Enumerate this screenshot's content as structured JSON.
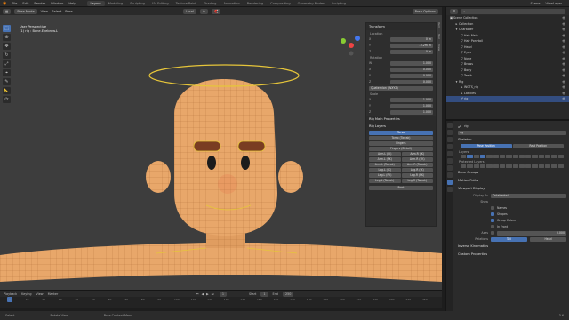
{
  "menu": [
    "File",
    "Edit",
    "Render",
    "Window",
    "Help"
  ],
  "workspaces": [
    "Layout",
    "Modeling",
    "Sculpting",
    "UV Editing",
    "Texture Paint",
    "Shading",
    "Animation",
    "Rendering",
    "Compositing",
    "Geometry Nodes",
    "Scripting"
  ],
  "active_workspace": "Layout",
  "scene": "Scene",
  "view_layer": "ViewLayer",
  "viewport": {
    "mode": "Pose Mode",
    "menus": [
      "View",
      "Select",
      "Pose"
    ],
    "transform_orientation": "Local",
    "overlay_label": "Pose Options",
    "view_name": "User Perspective",
    "context": "(1) rig : Bone.Eyebrow.L"
  },
  "npanel": {
    "tabs": [
      "Item",
      "Tool",
      "View"
    ],
    "transform_header": "Transform",
    "location_label": "Location",
    "location": [
      {
        "axis": "X",
        "value": "0 m"
      },
      {
        "axis": "Y",
        "value": "-0.2m m"
      },
      {
        "axis": "Z",
        "value": "0 m"
      }
    ],
    "rotation_label": "Rotation",
    "rotation": [
      {
        "axis": "W",
        "value": "1.000"
      },
      {
        "axis": "X",
        "value": "0.000"
      },
      {
        "axis": "Y",
        "value": "0.000"
      },
      {
        "axis": "Z",
        "value": "0.000"
      }
    ],
    "rotation_mode": "Quaternion (WXYZ)",
    "scale_label": "Scale",
    "scale": [
      {
        "axis": "X",
        "value": "1.000"
      },
      {
        "axis": "Y",
        "value": "1.000"
      },
      {
        "axis": "Z",
        "value": "1.000"
      }
    ],
    "rig_main_properties": "Rig Main Properties",
    "rig_layers_header": "Rig Layers",
    "layers_single": [
      "Torso",
      "Torso (Tweak)",
      "Fingers",
      "Fingers (Detail)"
    ],
    "layers_pairs": [
      [
        "Arm.L (IK)",
        "Arm.R (IK)"
      ],
      [
        "Arm.L (FK)",
        "Arm.R (FK)"
      ],
      [
        "Arm.L (Tweak)",
        "Arm.R (Tweak)"
      ],
      [
        "Leg.L (IK)",
        "Leg.R (IK)"
      ],
      [
        "Leg.L (FK)",
        "Leg.R (FK)"
      ],
      [
        "Leg.L (Tweak)",
        "Leg.R (Tweak)"
      ]
    ],
    "root_label": "Root"
  },
  "timeline": {
    "menus": [
      "Playback",
      "Keying",
      "View",
      "Marker"
    ],
    "current_frame": "1",
    "start_label": "Start",
    "start": "1",
    "end_label": "End",
    "end": "250",
    "ticks": [
      "0",
      "10",
      "20",
      "30",
      "40",
      "50",
      "60",
      "70",
      "80",
      "90",
      "100",
      "110",
      "120",
      "130",
      "140",
      "150",
      "160",
      "170",
      "180",
      "190",
      "200",
      "210",
      "220",
      "230",
      "240",
      "250"
    ]
  },
  "statusbar": [
    "Select",
    "Rotate View",
    "Pose Context Menu"
  ],
  "version": "3.6",
  "outliner": {
    "rows": [
      {
        "label": "Scene Collection",
        "indent": 0,
        "icon": "▣",
        "selected": false
      },
      {
        "label": "Collection",
        "indent": 1,
        "icon": "▸",
        "selected": false
      },
      {
        "label": "Character",
        "indent": 1,
        "icon": "▾",
        "selected": false
      },
      {
        "label": "Hair Main",
        "indent": 2,
        "icon": "▽",
        "selected": false
      },
      {
        "label": "Hair Ponytail",
        "indent": 2,
        "icon": "▽",
        "selected": false
      },
      {
        "label": "Head",
        "indent": 2,
        "icon": "▽",
        "selected": false
      },
      {
        "label": "Eyes",
        "indent": 2,
        "icon": "▽",
        "selected": false
      },
      {
        "label": "Nose",
        "indent": 2,
        "icon": "▽",
        "selected": false
      },
      {
        "label": "Brows",
        "indent": 2,
        "icon": "▽",
        "selected": false
      },
      {
        "label": "Body",
        "indent": 2,
        "icon": "▽",
        "selected": false
      },
      {
        "label": "Teeth",
        "indent": 2,
        "icon": "▽",
        "selected": false
      },
      {
        "label": "Rig",
        "indent": 1,
        "icon": "▾",
        "selected": false
      },
      {
        "label": "WGTS_rig",
        "indent": 2,
        "icon": "▸",
        "selected": false
      },
      {
        "label": "Lattices",
        "indent": 2,
        "icon": "▸",
        "selected": false
      },
      {
        "label": "rig",
        "indent": 2,
        "icon": "☍",
        "selected": true
      }
    ]
  },
  "properties": {
    "object_name": "rig",
    "data_name": "rig",
    "skeleton_header": "Skeleton",
    "pose_position": "Pose Position",
    "rest_position": "Rest Position",
    "layers_label": "Layers",
    "protected_layers_label": "Protected Layers",
    "sections_collapsed": [
      "Bone Groups",
      "Motion Paths"
    ],
    "viewport_display_header": "Viewport Display",
    "display_as_label": "Display As",
    "display_as": "Octahedral",
    "show_label": "Show",
    "show_options": [
      {
        "label": "Names",
        "checked": false
      },
      {
        "label": "Shapes",
        "checked": true
      },
      {
        "label": "Group Colors",
        "checked": true
      },
      {
        "label": "In Front",
        "checked": false
      }
    ],
    "axes_label": "Axes",
    "axes_value": "0.000",
    "relations_label": "Relations",
    "relations": [
      "Tail",
      "Head"
    ],
    "more_sections": [
      "Inverse Kinematics",
      "Custom Properties"
    ]
  },
  "colors": {
    "accent": "#4772b3",
    "skin": "#e8a76a",
    "halo": "#e6c53a",
    "brow": "#7a3d22",
    "viewport_bg": "#3d3d3d"
  }
}
